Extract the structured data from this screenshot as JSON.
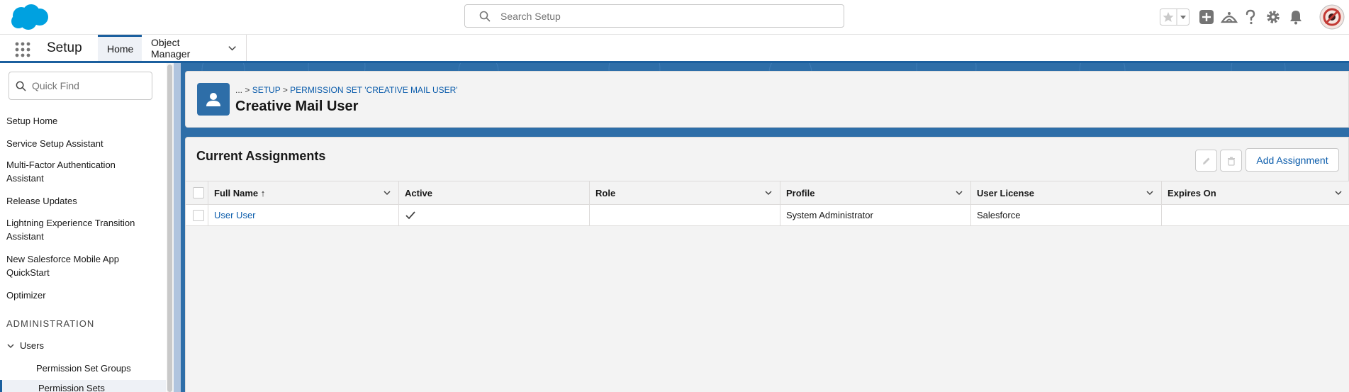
{
  "global_header": {
    "search_placeholder": "Search Setup"
  },
  "app_nav": {
    "app_name": "Setup",
    "tabs": [
      {
        "label": "Home"
      },
      {
        "label": "Object Manager"
      }
    ]
  },
  "sidebar": {
    "quick_find_placeholder": "Quick Find",
    "items": [
      {
        "label": "Setup Home"
      },
      {
        "label": "Service Setup Assistant"
      },
      {
        "label": "Multi-Factor Authentication Assistant"
      },
      {
        "label": "Release Updates"
      },
      {
        "label": "Lightning Experience Transition Assistant"
      },
      {
        "label": "New Salesforce Mobile App QuickStart"
      },
      {
        "label": "Optimizer"
      }
    ],
    "section_title": "ADMINISTRATION",
    "users_label": "Users",
    "sub_items": [
      {
        "label": "Permission Set Groups"
      },
      {
        "label": "Permission Sets"
      }
    ]
  },
  "page_header": {
    "breadcrumb_prefix": "... > ",
    "breadcrumb_setup": "SETUP",
    "breadcrumb_sep": " > ",
    "breadcrumb_permset": "PERMISSION SET 'CREATIVE MAIL USER'",
    "title": "Creative Mail User"
  },
  "assignments": {
    "title": "Current Assignments",
    "add_button": "Add Assignment",
    "columns": [
      {
        "label": "Full Name ↑"
      },
      {
        "label": "Active"
      },
      {
        "label": "Role"
      },
      {
        "label": "Profile"
      },
      {
        "label": "User License"
      },
      {
        "label": "Expires On"
      }
    ],
    "rows": [
      {
        "full_name": "User User",
        "active": true,
        "role": "",
        "profile": "System Administrator",
        "user_license": "Salesforce",
        "expires_on": ""
      }
    ]
  },
  "colors": {
    "brand_blue": "#0b5cab",
    "header_band": "#2e6ea8",
    "nav_accent": "#1b5f9e"
  }
}
